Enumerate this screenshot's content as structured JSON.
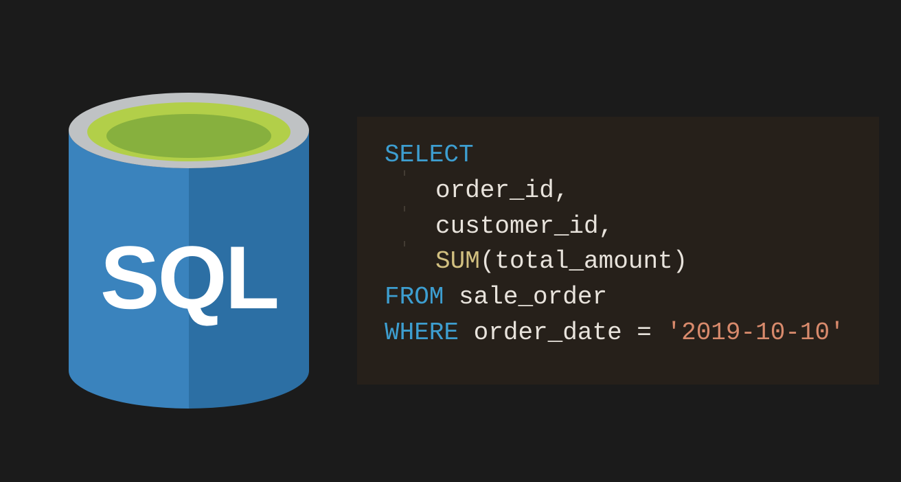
{
  "logo": {
    "label": "SQL"
  },
  "code": {
    "line1": {
      "keyword": "SELECT"
    },
    "line2": {
      "text": "order_id,"
    },
    "line3": {
      "text": "customer_id,"
    },
    "line4": {
      "func": "SUM",
      "open": "(",
      "arg": "total_amount",
      "close": ")"
    },
    "line5": {
      "keyword": "FROM",
      "table": " sale_order"
    },
    "line6": {
      "keyword": "WHERE",
      "col": " order_date ",
      "op": "=",
      "sp": " ",
      "string": "'2019-10-10'"
    }
  }
}
